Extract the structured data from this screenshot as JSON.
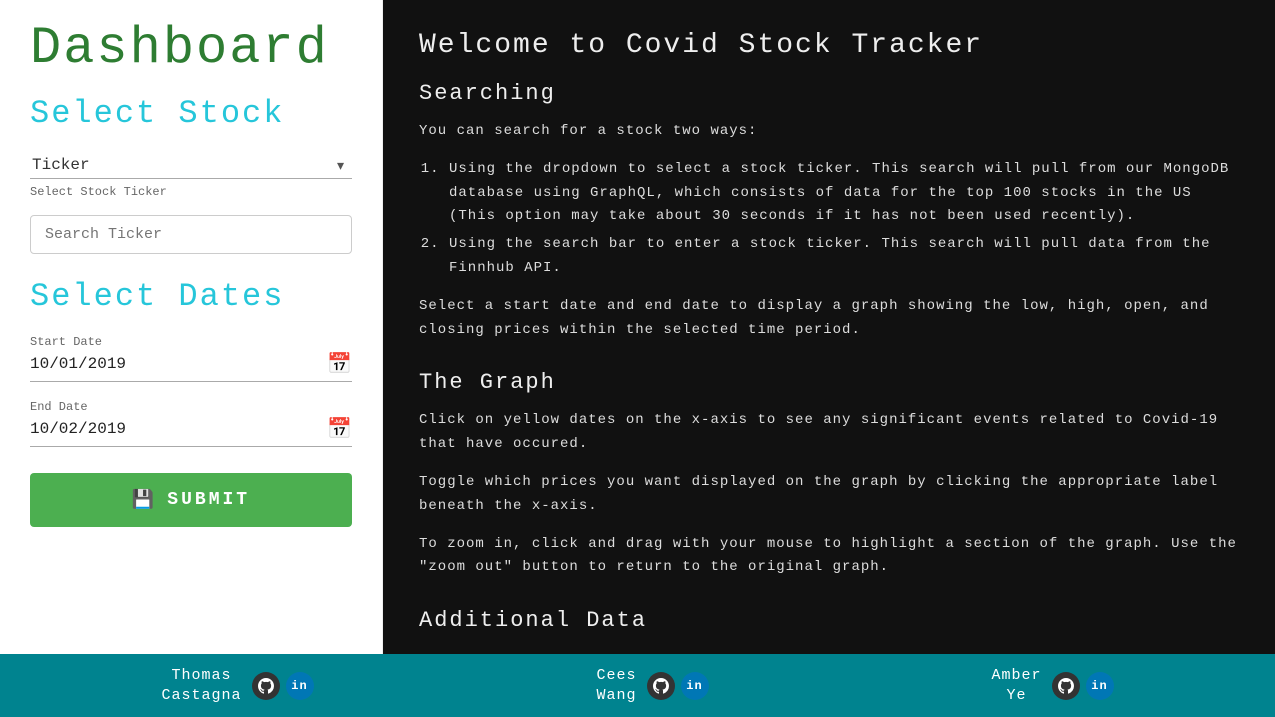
{
  "sidebar": {
    "title": "Dashboard",
    "select_stock_heading": "Select Stock",
    "ticker_label": "Ticker",
    "select_stock_ticker_label": "Select Stock Ticker",
    "search_placeholder": "Search Ticker",
    "select_dates_heading": "Select Dates",
    "start_date_label": "Start Date",
    "start_date_value": "10/01/2019",
    "end_date_label": "End Date",
    "end_date_value": "10/02/2019",
    "submit_label": "SUBMIT"
  },
  "content": {
    "title": "Welcome to Covid Stock Tracker",
    "searching_heading": "Searching",
    "searching_intro": "You can search for a stock two ways:",
    "searching_items": [
      "Using the dropdown to select a stock ticker. This search will pull from our MongoDB database using GraphQL, which consists of data for the top 100 stocks in the US (This option may take about 30 seconds if it has not been used recently).",
      "Using the search bar to enter a stock ticker. This search will pull data from the Finnhub API."
    ],
    "searching_note": "Select a start date and end date to display a graph showing the low, high, open, and closing prices within the selected time period.",
    "graph_heading": "The Graph",
    "graph_text1": "Click on yellow dates on the x-axis to see any significant events related to Covid-19 that have occured.",
    "graph_text2": "Toggle which prices you want displayed on the graph by clicking the appropriate label beneath the x-axis.",
    "graph_text3": "To zoom in, click and drag with your mouse to highlight a section of the graph. Use the \"zoom out\" button to return to the original graph.",
    "additional_heading": "Additional Data"
  },
  "footer": {
    "persons": [
      {
        "name": "Thomas\nCastagna"
      },
      {
        "name": "Cees\nWang"
      },
      {
        "name": "Amber\nYe"
      }
    ]
  },
  "colors": {
    "green": "#4caf50",
    "teal_heading": "#26c6da",
    "footer_bg": "#00838f"
  }
}
